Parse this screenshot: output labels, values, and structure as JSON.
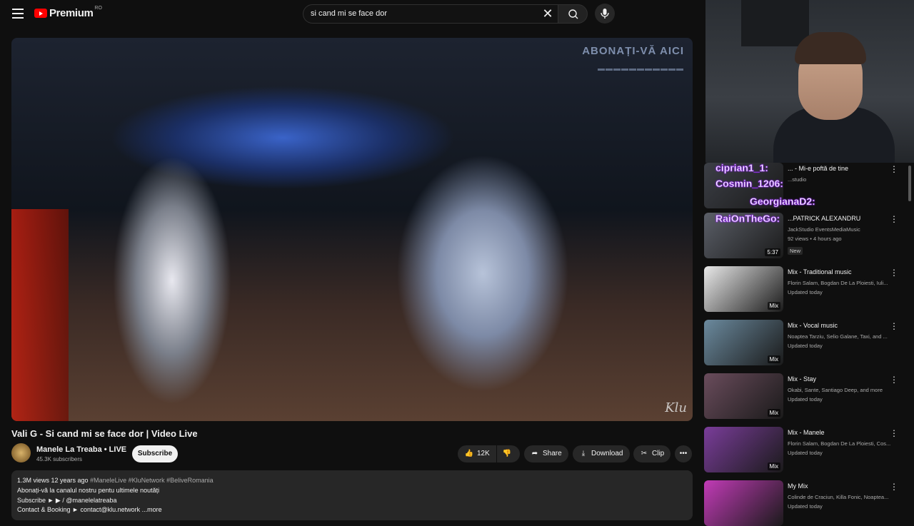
{
  "header": {
    "logo_text": "Premium",
    "logo_country": "RO",
    "search_query": "si cand mi se face dor"
  },
  "video": {
    "watermark_line1": "ABONAȚI-VĂ AICI",
    "watermark_logo": "Klu",
    "title": "Vali G - Si cand mi se face dor | Video Live"
  },
  "channel": {
    "name": "Manele La Treaba • LIVE",
    "subscribers": "45.3K subscribers",
    "subscribe_label": "Subscribe"
  },
  "actions": {
    "likes": "12K",
    "share": "Share",
    "download": "Download",
    "clip": "Clip"
  },
  "description": {
    "views_age": "1.3M views  12 years ago",
    "tags": "#ManeleLive #KluNetwork #BeliveRomania",
    "line1": "Abonați-vă la canalul nostru pentu ultimele noutăți",
    "line2": "Subscribe ► ▶ / @manelelatreaba",
    "line3": "Contact & Booking ► contact@klu.network",
    "more": "...more"
  },
  "chat_overlay": [
    "ciprian1_1:",
    "Cosmin_1206:",
    "GeorgianaD2:",
    "RaiOnTheGo:"
  ],
  "recommendations": [
    {
      "title": "... - Mi-e poftă de tine",
      "sub": "...studio",
      "updated": "",
      "badge": "",
      "accent": "#3c3f46"
    },
    {
      "title": "...PATRICK ALEXANDRU",
      "sub": "JackStudio EventsMediaMusic",
      "updated": "92 views • 4 hours ago",
      "badge": "5:37",
      "new_label": "New",
      "accent": "#5b5f68"
    },
    {
      "title": "Mix - Traditional music",
      "sub": "Florin Salam, Bogdan De La Ploiesti, Iuli...",
      "updated": "Updated today",
      "badge": "Mix",
      "accent": "#e9e9e9"
    },
    {
      "title": "Mix - Vocal music",
      "sub": "Noaptea Tarziu, Selio Galane, Taxi, and ...",
      "updated": "Updated today",
      "badge": "Mix",
      "accent": "#6b8a9e"
    },
    {
      "title": "Mix - Stay",
      "sub": "Okabi, Sante, Santiago Deep, and more",
      "updated": "Updated today",
      "badge": "Mix",
      "accent": "#6a4c5c"
    },
    {
      "title": "Mix - Manele",
      "sub": "Florin Salam, Bogdan De La Ploiesti, Cos...",
      "updated": "Updated today",
      "badge": "Mix",
      "accent": "#7a3d9a"
    },
    {
      "title": "My Mix",
      "sub": "Colinde de Craciun, Killa Fonic, Noaptea...",
      "updated": "Updated today",
      "badge": "",
      "accent": "#c23bb7"
    }
  ]
}
